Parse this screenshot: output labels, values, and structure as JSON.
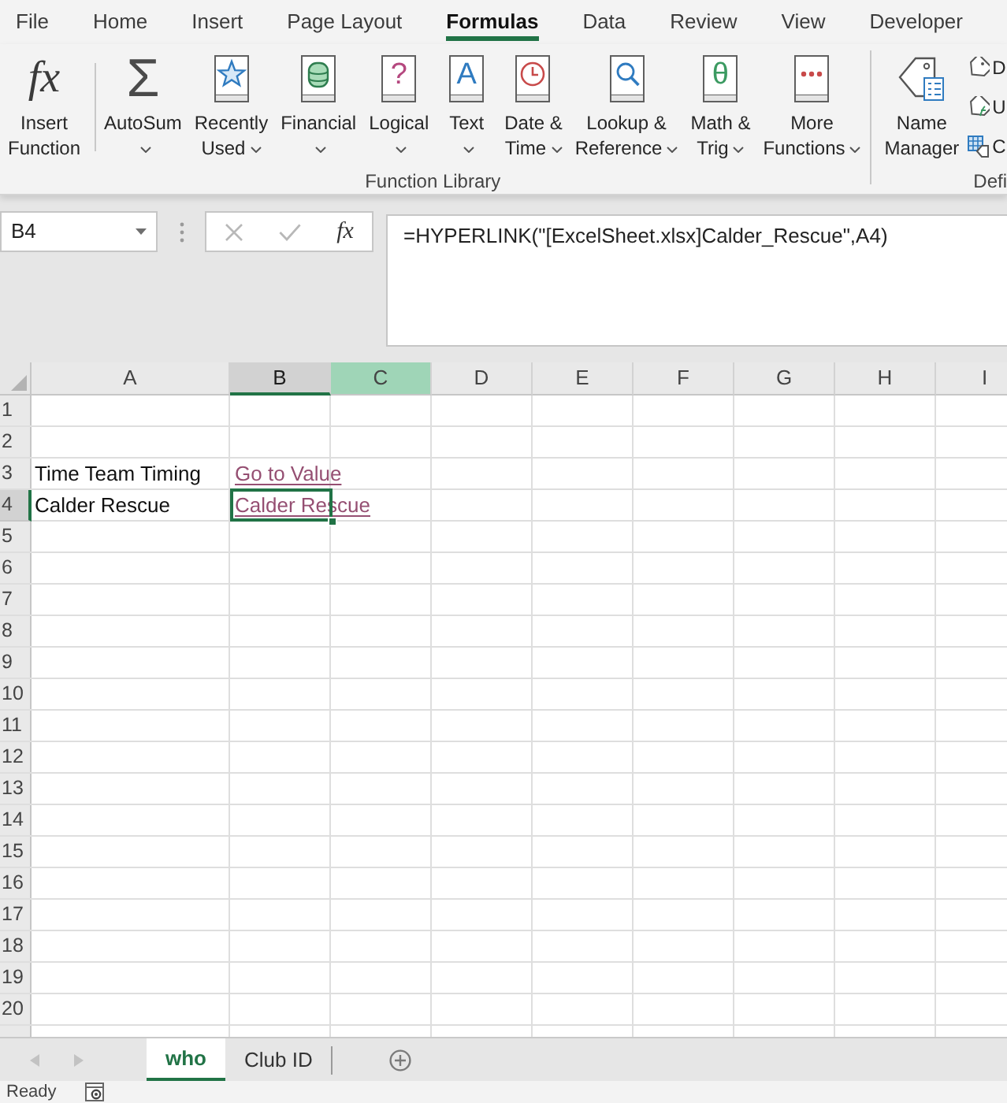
{
  "menu_tabs": [
    {
      "label": "File",
      "selected": false
    },
    {
      "label": "Home",
      "selected": false
    },
    {
      "label": "Insert",
      "selected": false
    },
    {
      "label": "Page Layout",
      "selected": false
    },
    {
      "label": "Formulas",
      "selected": true
    },
    {
      "label": "Data",
      "selected": false
    },
    {
      "label": "Review",
      "selected": false
    },
    {
      "label": "View",
      "selected": false
    },
    {
      "label": "Developer",
      "selected": false
    }
  ],
  "ribbon": {
    "groups": [
      {
        "label": "Function Library",
        "buttons": [
          {
            "glyph": "fx",
            "lines": [
              "Insert",
              "Function"
            ],
            "dropdown": false,
            "separator_after": true
          },
          {
            "glyph": "Σ",
            "lines": [
              "AutoSum"
            ],
            "dropdown": true
          },
          {
            "lines": [
              "Recently",
              "Used"
            ],
            "dropdown": true
          },
          {
            "lines": [
              "Financial"
            ],
            "dropdown": true
          },
          {
            "glyph": "?",
            "lines": [
              "Logical"
            ],
            "dropdown": true
          },
          {
            "glyph": "A",
            "lines": [
              "Text"
            ],
            "dropdown": true
          },
          {
            "lines": [
              "Date &",
              "Time"
            ],
            "dropdown": true
          },
          {
            "lines": [
              "Lookup &",
              "Reference"
            ],
            "dropdown": true
          },
          {
            "glyph": "θ",
            "lines": [
              "Math &",
              "Trig"
            ],
            "dropdown": true
          },
          {
            "lines": [
              "More",
              "Functions"
            ],
            "dropdown": true
          }
        ]
      },
      {
        "label": "Defi",
        "buttons": [
          {
            "lines": [
              "Name",
              "Manager"
            ],
            "dropdown": false
          }
        ],
        "small_buttons": [
          {
            "label": "D"
          },
          {
            "label": "U"
          },
          {
            "label": "C"
          }
        ]
      }
    ]
  },
  "formula_bar": {
    "name_box": "B4",
    "buttons": [
      {
        "kind": "cancel",
        "disabled": true
      },
      {
        "kind": "enter",
        "disabled": true
      },
      {
        "kind": "function",
        "glyph": "fx",
        "disabled": false
      }
    ],
    "formula": "=HYPERLINK(\"[ExcelSheet.xlsx]Calder_Rescue\",A4)"
  },
  "grid": {
    "columns": [
      {
        "label": "A",
        "selected": false,
        "highlighted": false
      },
      {
        "label": "B",
        "selected": true,
        "highlighted": false
      },
      {
        "label": "C",
        "selected": false,
        "highlighted": true
      },
      {
        "label": "D",
        "selected": false,
        "highlighted": false
      },
      {
        "label": "E",
        "selected": false,
        "highlighted": false
      },
      {
        "label": "F",
        "selected": false,
        "highlighted": false
      },
      {
        "label": "G",
        "selected": false,
        "highlighted": false
      },
      {
        "label": "H",
        "selected": false,
        "highlighted": false
      },
      {
        "label": "I",
        "selected": false,
        "highlighted": false
      }
    ],
    "rows": [
      {
        "label": "1",
        "selected": false
      },
      {
        "label": "2",
        "selected": false
      },
      {
        "label": "3",
        "selected": false,
        "cells": [
          {
            "kind": "text",
            "text": "Time Team Timing",
            "selected": false
          },
          {
            "kind": "hyperlink",
            "text": "Go to Value",
            "selected": false
          }
        ]
      },
      {
        "label": "4",
        "selected": true,
        "cells": [
          {
            "kind": "text",
            "text": "Calder Rescue",
            "selected": false
          },
          {
            "kind": "hyperlink",
            "text": "Calder Rescue",
            "selected": true
          }
        ]
      },
      {
        "label": "5",
        "selected": false
      },
      {
        "label": "6",
        "selected": false
      },
      {
        "label": "7",
        "selected": false
      },
      {
        "label": "8",
        "selected": false
      },
      {
        "label": "9",
        "selected": false
      },
      {
        "label": "10",
        "selected": false
      },
      {
        "label": "11",
        "selected": false
      },
      {
        "label": "12",
        "selected": false
      },
      {
        "label": "13",
        "selected": false
      },
      {
        "label": "14",
        "selected": false
      },
      {
        "label": "15",
        "selected": false
      },
      {
        "label": "16",
        "selected": false
      },
      {
        "label": "17",
        "selected": false
      },
      {
        "label": "18",
        "selected": false
      },
      {
        "label": "19",
        "selected": false
      },
      {
        "label": "20",
        "selected": false
      }
    ]
  },
  "sheet_bar": {
    "nav": [
      {
        "kind": "previous",
        "disabled": true
      },
      {
        "kind": "next",
        "disabled": true
      }
    ],
    "tabs": [
      {
        "label": "who",
        "selected": true
      },
      {
        "label": "Club ID",
        "selected": false
      }
    ]
  },
  "status_bar": {
    "text": "Ready"
  }
}
